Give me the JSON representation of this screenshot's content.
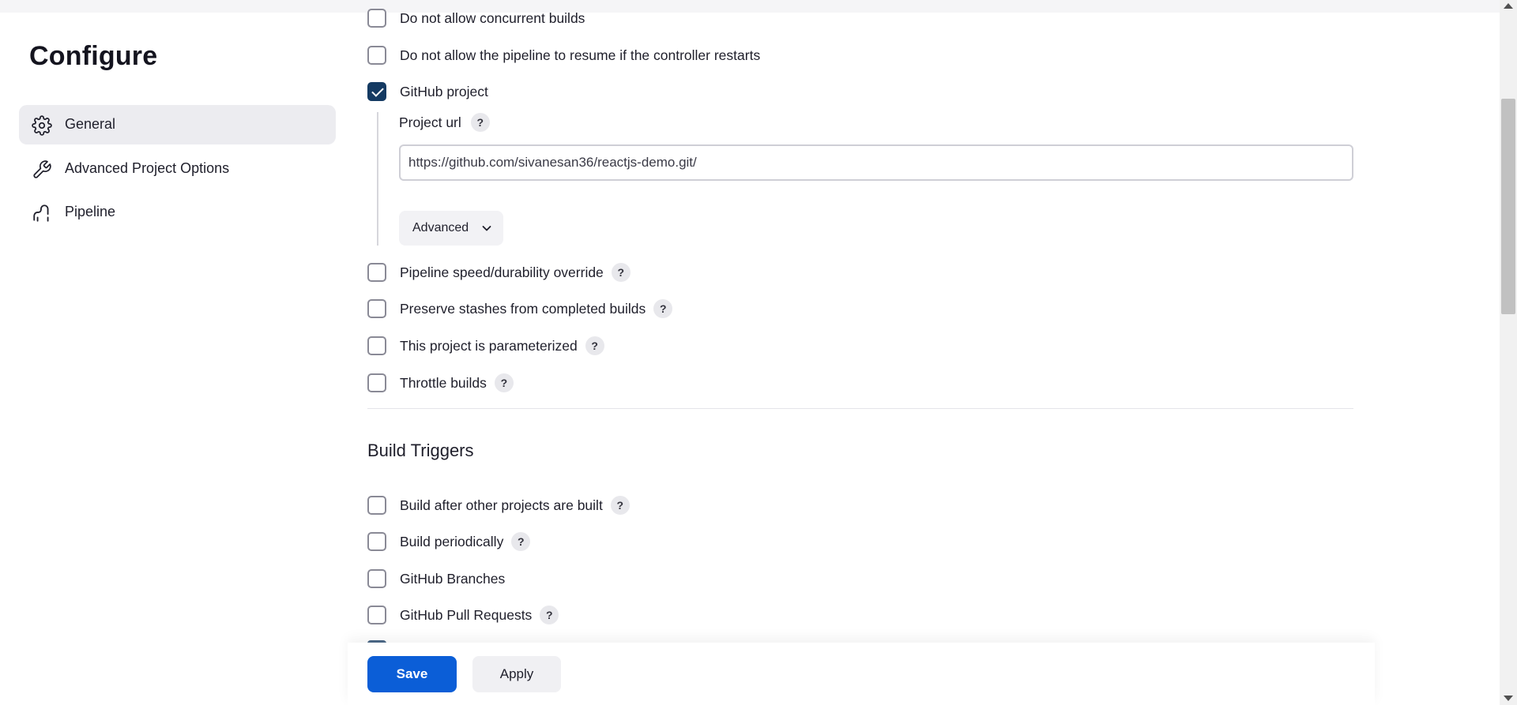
{
  "sidebar": {
    "title": "Configure",
    "items": [
      {
        "label": "General",
        "icon": "gear-icon",
        "active": true
      },
      {
        "label": "Advanced Project Options",
        "icon": "wrench-icon",
        "active": false
      },
      {
        "label": "Pipeline",
        "icon": "pipeline-icon",
        "active": false
      }
    ]
  },
  "general": {
    "options": [
      {
        "label": "Do not allow concurrent builds",
        "checked": false,
        "help": false
      },
      {
        "label": "Do not allow the pipeline to resume if the controller restarts",
        "checked": false,
        "help": false
      },
      {
        "label": "GitHub project",
        "checked": true,
        "help": false
      }
    ],
    "github_project": {
      "field_label": "Project url",
      "help": "?",
      "url_value": "https://github.com/sivanesan36/reactjs-demo.git/",
      "advanced_label": "Advanced"
    },
    "more_options": [
      {
        "label": "Pipeline speed/durability override",
        "checked": false,
        "help": "?"
      },
      {
        "label": "Preserve stashes from completed builds",
        "checked": false,
        "help": "?"
      },
      {
        "label": "This project is parameterized",
        "checked": false,
        "help": "?"
      },
      {
        "label": "Throttle builds",
        "checked": false,
        "help": "?"
      }
    ]
  },
  "build_triggers": {
    "title": "Build Triggers",
    "options": [
      {
        "label": "Build after other projects are built",
        "checked": false,
        "help": "?"
      },
      {
        "label": "Build periodically",
        "checked": false,
        "help": "?"
      },
      {
        "label": "GitHub Branches",
        "checked": false,
        "help": ""
      },
      {
        "label": "GitHub Pull Requests",
        "checked": false,
        "help": "?"
      }
    ]
  },
  "footer": {
    "save_label": "Save",
    "apply_label": "Apply"
  },
  "colors": {
    "accent": "#0b5ed7",
    "checked": "#143a62",
    "active_nav_bg": "#ececf0"
  }
}
